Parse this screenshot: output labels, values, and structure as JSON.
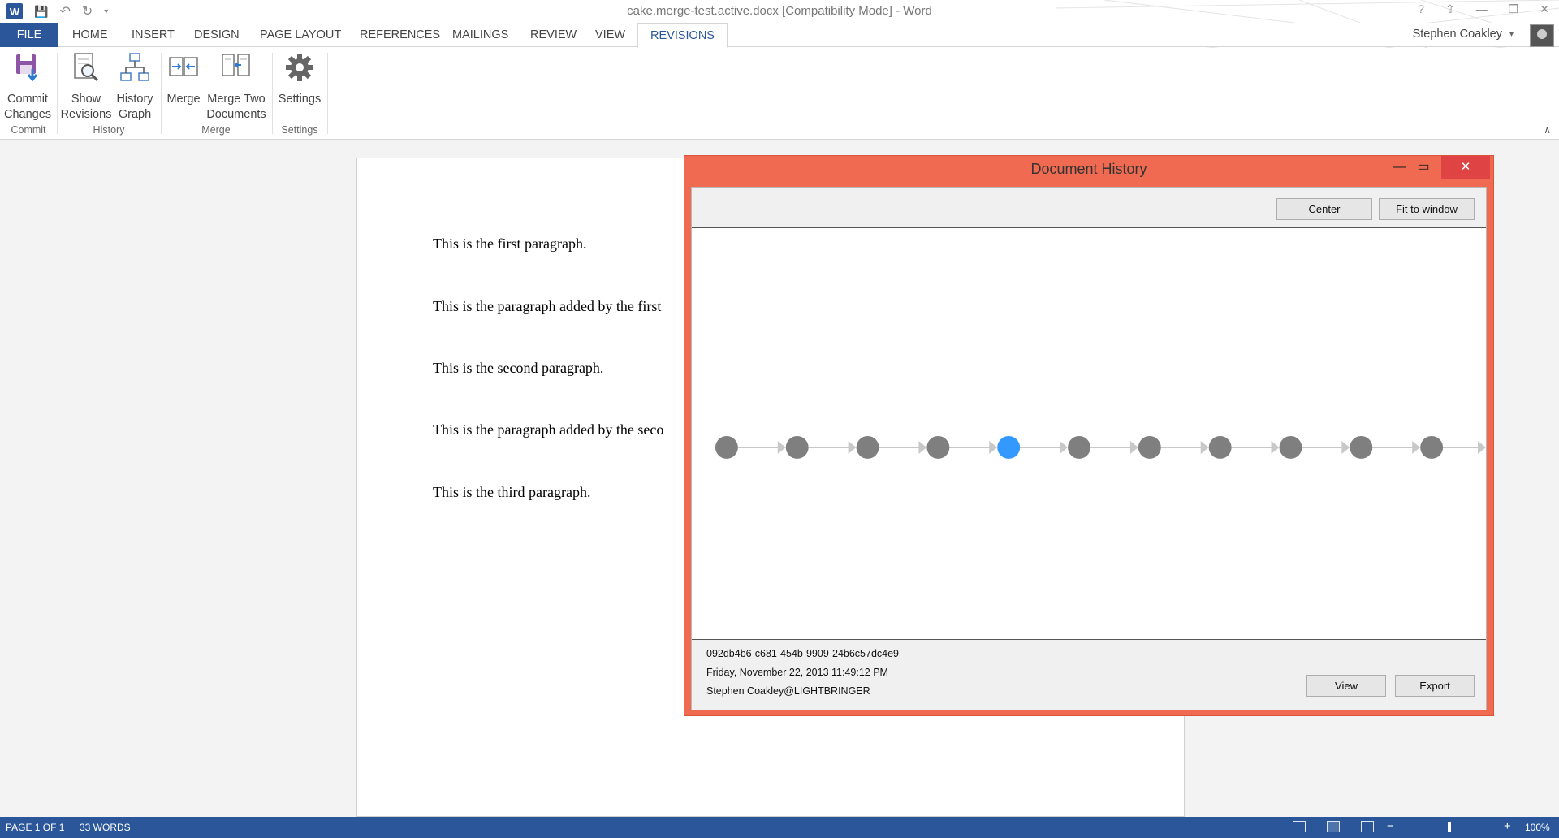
{
  "window": {
    "title": "cake.merge-test.active.docx [Compatibility Mode] - Word",
    "help": "?",
    "minimize": "—",
    "maximize": "❐",
    "close": "✕"
  },
  "qat": {
    "app_icon": "W",
    "save": "💾",
    "undo": "↶",
    "redo": "↻"
  },
  "tabs": [
    {
      "label": "FILE"
    },
    {
      "label": "HOME"
    },
    {
      "label": "INSERT"
    },
    {
      "label": "DESIGN"
    },
    {
      "label": "PAGE LAYOUT"
    },
    {
      "label": "REFERENCES"
    },
    {
      "label": "MAILINGS"
    },
    {
      "label": "REVIEW"
    },
    {
      "label": "VIEW"
    },
    {
      "label": "REVISIONS"
    }
  ],
  "active_tab": "REVISIONS",
  "user": {
    "name": "Stephen Coakley",
    "caret": "▾"
  },
  "ribbon": {
    "commit": {
      "line1": "Commit",
      "line2": "Changes",
      "group": "Commit",
      "icon": "save-commit-icon"
    },
    "show_revisions": {
      "line1": "Show",
      "line2": "Revisions",
      "icon": "magnify-document-icon"
    },
    "history_graph": {
      "line1": "History",
      "line2": "Graph",
      "icon": "tree-graph-icon"
    },
    "history_group": "History",
    "merge": {
      "line1": "Merge",
      "icon": "merge-icon"
    },
    "merge_two": {
      "line1": "Merge Two",
      "line2": "Documents",
      "icon": "merge-documents-icon"
    },
    "merge_group": "Merge",
    "settings": {
      "line1": "Settings",
      "group": "Settings",
      "icon": "gear-icon"
    },
    "collapse": "∧"
  },
  "document": {
    "paragraphs": [
      "This is the first paragraph.",
      "This is the paragraph added by the first",
      "This is the second paragraph.",
      "This is the paragraph added by the seco",
      "This is the third paragraph."
    ]
  },
  "dialog": {
    "title": "Document History",
    "min": "—",
    "max": "▭",
    "close": "✕",
    "center_label": "Center",
    "fit_label": "Fit to window",
    "node_count": 11,
    "selected_index": 4,
    "node_color": "#7f7f7f",
    "selected_color": "#3399ff",
    "edge_color": "#c8c8c8",
    "info": {
      "id": "092db4b6-c681-454b-9909-24b6c57dc4e9",
      "date": "Friday, November 22, 2013 11:49:12 PM",
      "author": "Stephen Coakley@LIGHTBRINGER"
    },
    "view_label": "View",
    "export_label": "Export"
  },
  "status": {
    "page": "PAGE 1 OF 1",
    "words": "33 WORDS",
    "zoom_minus": "−",
    "zoom_plus": "+",
    "zoom": "100%"
  },
  "colors": {
    "accent": "#2b579a",
    "dialog_frame": "#ef6a51"
  }
}
